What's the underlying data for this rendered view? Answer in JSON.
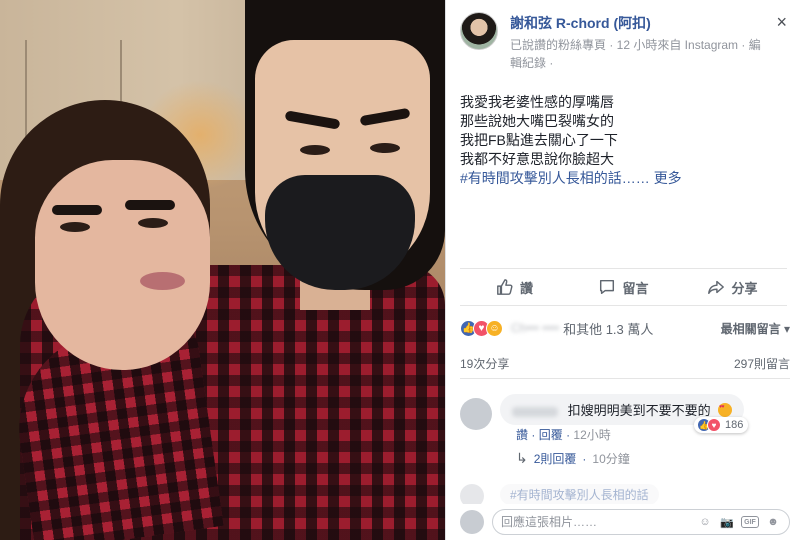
{
  "header": {
    "page_name": "謝和弦 R-chord (阿扣)",
    "meta": "已說讚的粉絲專頁 · 12 小時來自 Instagram · 編輯紀錄 ·",
    "close": "×"
  },
  "post": {
    "lines": [
      "我愛我老婆性感的厚嘴唇",
      "那些說她大嘴巴裂嘴女的",
      "我把FB點進去關心了一下",
      "我都不好意思說你臉超大"
    ],
    "hashtag": "#有時間攻擊別人長相的話……",
    "more": "更多"
  },
  "actions": {
    "like": "讚",
    "comment": "留言",
    "share": "分享"
  },
  "reactions": {
    "others": "和其他 1.3 萬人",
    "sort": "最相關留言 ▾",
    "colors": {
      "like": "#4267b2",
      "love": "#f25268",
      "haha": "#f7b125"
    }
  },
  "stats": {
    "shares": "19次分享",
    "views": "297則留言"
  },
  "comment": {
    "text": "扣嫂明明美到不要不要的",
    "reaction_count": "186",
    "like": "讚",
    "reply": "回覆",
    "time": "12小時"
  },
  "replies": {
    "label": "2則回覆",
    "time": "10分鐘"
  },
  "faded_comment": {
    "text": "#有時間攻擊別人長相的話"
  },
  "composer": {
    "placeholder": "回應這張相片……"
  }
}
